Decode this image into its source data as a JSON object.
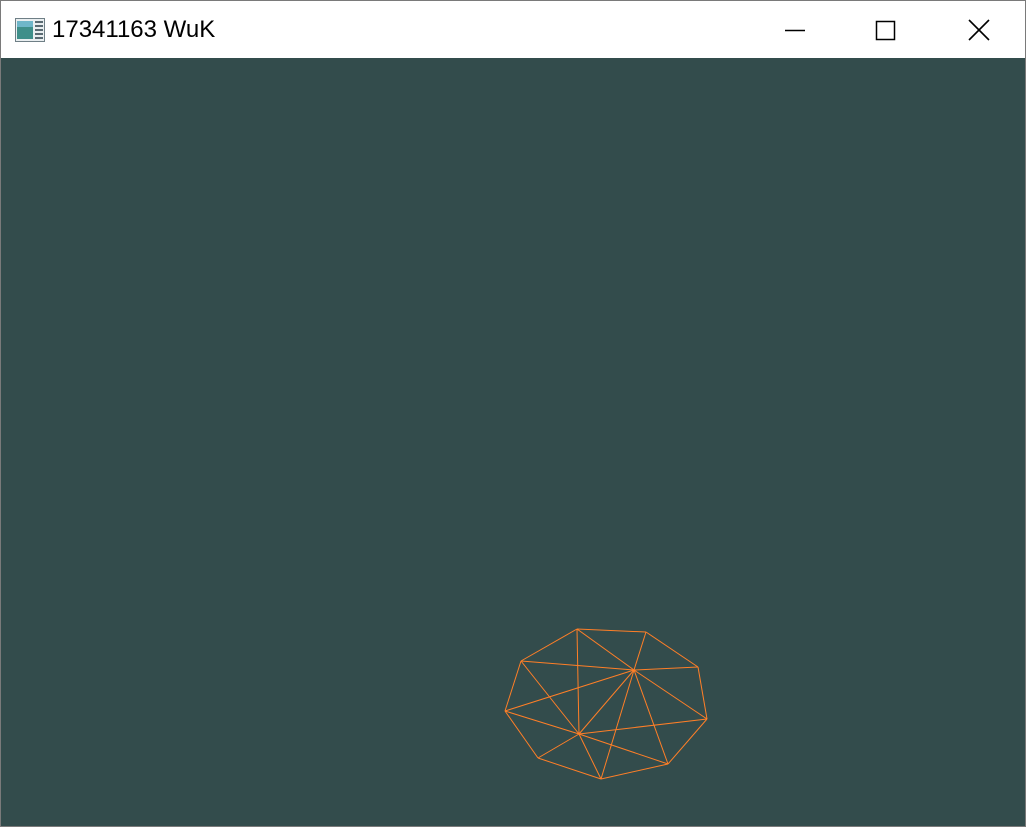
{
  "window": {
    "title": "17341163 WuK",
    "icon": "application-window-icon",
    "controls": {
      "minimize_icon": "minimize-icon",
      "maximize_icon": "maximize-icon",
      "close_icon": "close-icon"
    }
  },
  "canvas": {
    "background_color": "#334c4c",
    "mesh": {
      "style": "wireframe",
      "line_color": "#ff7f27"
    }
  }
}
